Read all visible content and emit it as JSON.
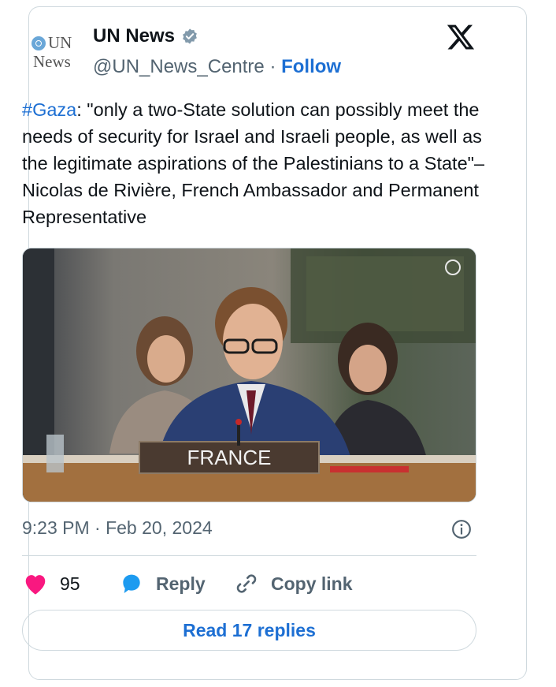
{
  "account": {
    "avatar_line1": "UN",
    "avatar_line2": "News",
    "name": "UN News",
    "handle": "@UN_News_Centre",
    "separator": " · ",
    "follow_label": "Follow"
  },
  "tweet": {
    "hashtag": "#Gaza",
    "body": ": \"only a two-State solution can possibly meet the needs of security for Israel and Israeli people, as well as the legitimate aspirations of the Palestinians to a State\"– Nicolas de Rivière, French Ambassador and Permanent Representative",
    "timestamp": "9:23 PM · Feb 20, 2024"
  },
  "media": {
    "nameplate": "FRANCE"
  },
  "actions": {
    "likes": "95",
    "reply_label": "Reply",
    "copy_label": "Copy link",
    "read_replies_label": "Read 17 replies"
  },
  "colors": {
    "link": "#1d6fd3",
    "heart": "#f91880",
    "muted": "#536471",
    "border": "#cfd9de"
  },
  "icons": [
    "verified-badge-icon",
    "x-logo-icon",
    "info-icon",
    "heart-icon",
    "reply-bubble-icon",
    "link-icon"
  ]
}
